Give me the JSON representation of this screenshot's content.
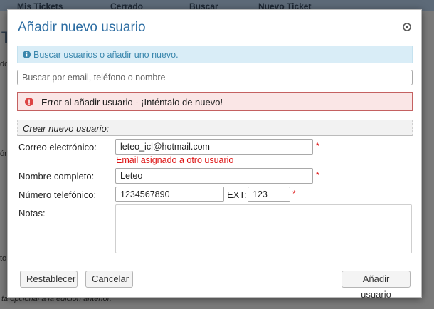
{
  "background": {
    "nav_items": [
      "Mis Tickets",
      "Cerrado",
      "Buscar",
      "Nuevo Ticket"
    ],
    "heading_letter": "T",
    "side_fragments": [
      "do",
      "ón:",
      "to"
    ],
    "bottom_text": "ta opcional a la edición anterior."
  },
  "modal": {
    "title": "Añadir nuevo usuario",
    "info_text": "Buscar usuarios o añadir uno nuevo.",
    "search_placeholder": "Buscar por email, teléfono o nombre",
    "error_text": "Error al añadir usuario - ¡Inténtalo de nuevo!",
    "section_title": "Crear nuevo usuario:",
    "fields": {
      "email_label": "Correo electrónico:",
      "email_value": "leteo_icl@hotmail.com",
      "email_error": "Email asignado a otro usuario",
      "name_label": "Nombre completo:",
      "name_value": "Leteo",
      "phone_label": "Número telefónico:",
      "phone_value": "1234567890",
      "ext_label": "EXT:",
      "ext_value": "123",
      "notes_label": "Notas:",
      "notes_value": "",
      "required_mark": "*"
    },
    "buttons": {
      "reset": "Restablecer",
      "cancel": "Cancelar",
      "add": "Añadir usuario"
    }
  },
  "colors": {
    "title": "#2e6ea3",
    "info_bg": "#d9edf7",
    "info_text": "#3a87ad",
    "error_bg": "#fae6e6",
    "error_border": "#c46161",
    "required": "#dd1111"
  }
}
